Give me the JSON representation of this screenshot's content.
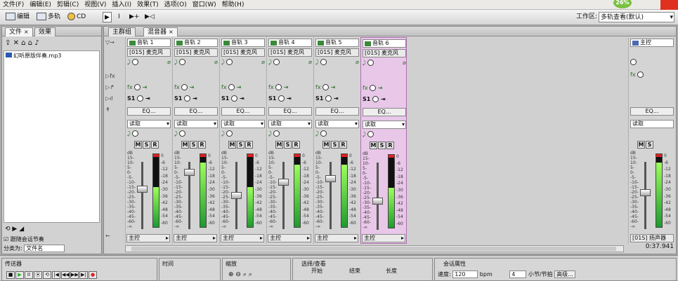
{
  "menu": [
    "文件(F)",
    "编辑(E)",
    "剪辑(C)",
    "视图(V)",
    "插入(I)",
    "效果(T)",
    "选项(O)",
    "窗口(W)",
    "帮助(H)"
  ],
  "toolbar": {
    "edit_label": "编辑",
    "multitrack_label": "多轨",
    "cd_label": "CD",
    "workspace_label": "工作区:",
    "workspace_value": "多轨查看(默认)",
    "cpu_badge": "26%"
  },
  "left_panel": {
    "tab_files": "文件",
    "tab_effects": "效果",
    "file_name": "幻听原版伴奏.mp3",
    "follow_session_label": "跟随会话节奏",
    "sort_label": "分类为:",
    "sort_value": "文件名"
  },
  "main_panel": {
    "tab_main_group": "主群组",
    "tab_mixer": "混音器"
  },
  "tracks": [
    {
      "name": "音轨 1",
      "input": "[01S] 麦克风",
      "send": "S1",
      "eq": "EQ...",
      "read": "读取",
      "db_a": "-18.8",
      "db_b": "-21.8",
      "level": 0.55,
      "fader": 0.6
    },
    {
      "name": "音轨 2",
      "input": "[01S] 麦克风",
      "send": "S1",
      "eq": "EQ...",
      "read": "读取",
      "db_a": "15",
      "db_b": "0.0",
      "level": 0.88,
      "fader": 0.88
    },
    {
      "name": "音轨 3",
      "input": "[01S] 麦克风",
      "send": "S1",
      "eq": "EQ...",
      "read": "读取",
      "db_a": "-15.6",
      "db_b": "-22.8",
      "level": 0.55,
      "fader": 0.5
    },
    {
      "name": "音轨 4",
      "input": "[01S] 麦克风",
      "send": "S1",
      "eq": "EQ...",
      "read": "读取",
      "db_a": "0",
      "db_b": "0.0",
      "level": 0.86,
      "fader": 0.72
    },
    {
      "name": "音轨 5",
      "input": "[01S] 麦克风",
      "send": "S1",
      "eq": "EQ...",
      "read": "读取",
      "db_a": "3.3",
      "db_b": "0.0",
      "level": 0.86,
      "fader": 0.78
    },
    {
      "name": "音轨 6",
      "input": "[01S] 麦克风",
      "send": "S1",
      "eq": "EQ...",
      "read": "读取",
      "db_a": "-25.2",
      "db_b": "-28.2",
      "level": 0.55,
      "fader": 0.42
    }
  ],
  "output_label": "主控",
  "master": {
    "name": "主控",
    "eq": "EQ...",
    "read": "读取",
    "db_a": "0",
    "db_b": "0.0",
    "level": 0.88,
    "fader": 0.55,
    "output": "[01S] 扬声器",
    "time": "0:37.941"
  },
  "scale_left": [
    "dB",
    "15-",
    "10-",
    "5-",
    "0-",
    "-5-",
    "-10-",
    "-15-",
    "-20-",
    "-25-",
    "-30-",
    "-35-",
    "-40-",
    "-45-",
    "-60-",
    "-∞"
  ],
  "scale_right": [
    "0",
    "-6",
    "-12",
    "-18",
    "-24",
    "-30",
    "-36",
    "-42",
    "-48",
    "-54",
    "-60"
  ],
  "bottom": {
    "transport_tab": "传送器",
    "time_tab": "时间",
    "zoom_tab": "缩放",
    "select_tab": "选择/查看",
    "start_label": "开始",
    "end_label": "结束",
    "length_label": "长度",
    "session_tab": "会话属性",
    "tempo_label": "速度:",
    "tempo_value": "120",
    "bpm_label": "bpm",
    "beats_value": "4",
    "beats_label": "小节/节拍",
    "advanced_label": "高级..."
  }
}
